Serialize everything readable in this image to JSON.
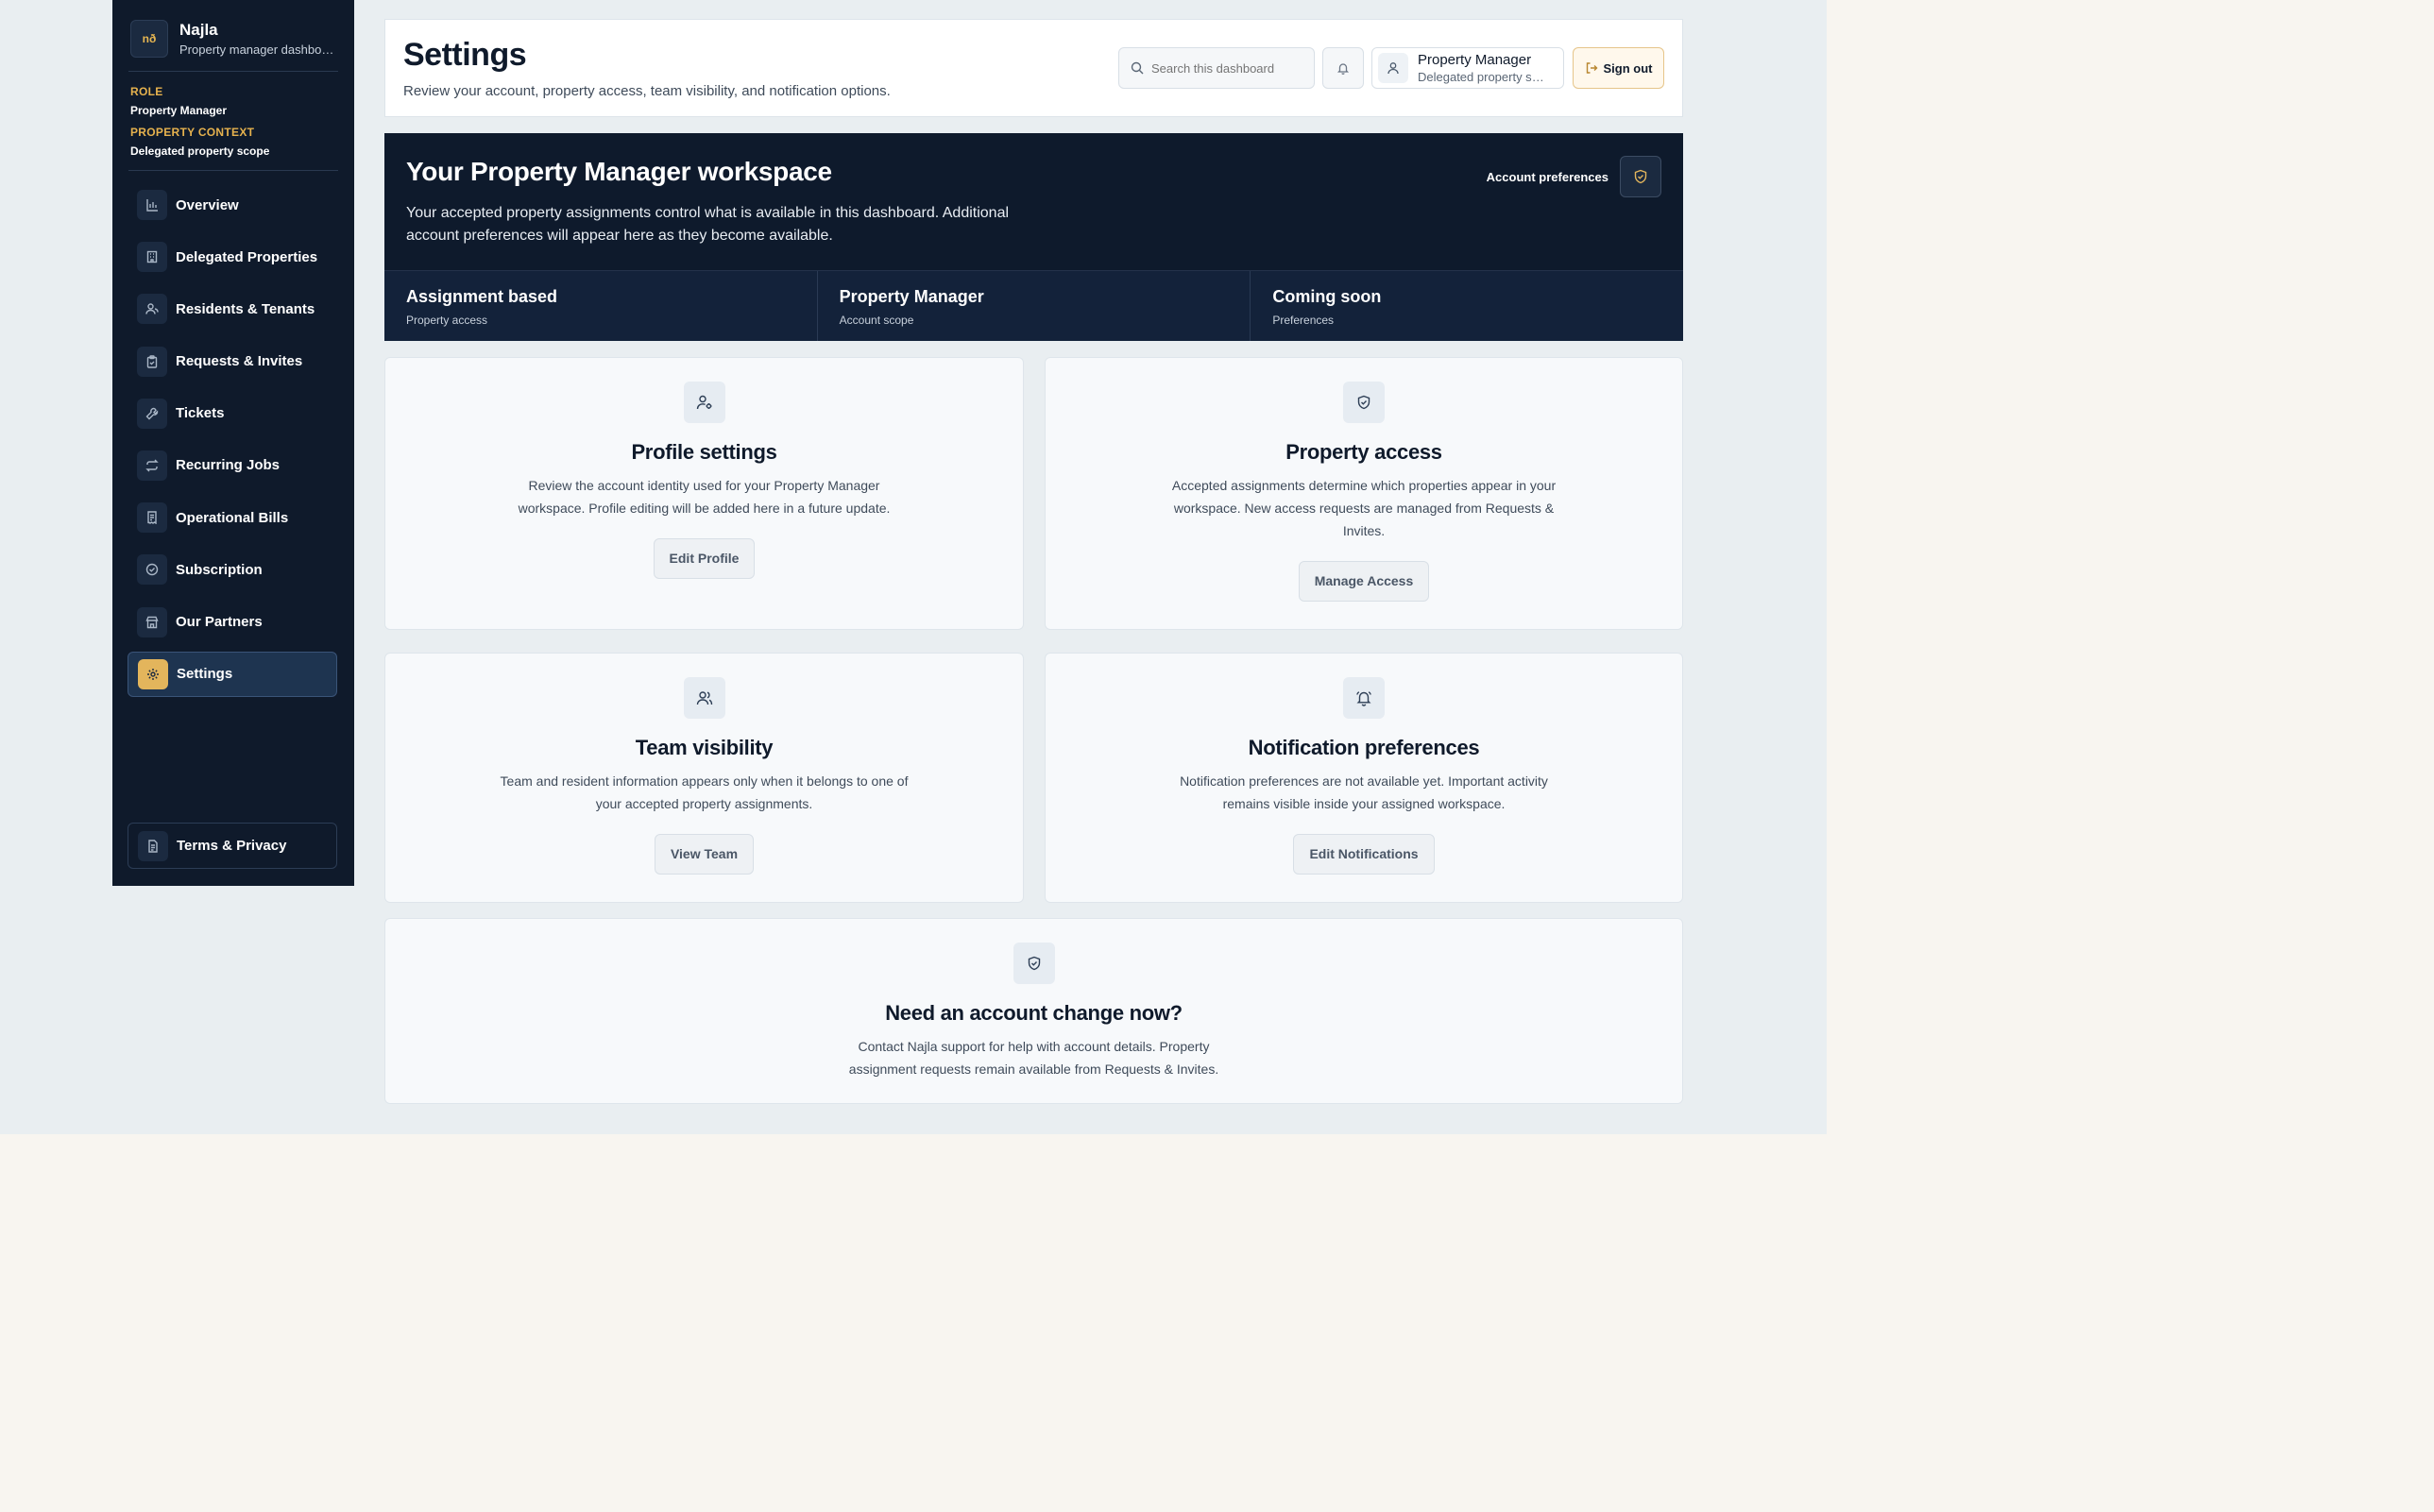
{
  "sidebar": {
    "brand": {
      "logo_text": "nð",
      "name": "Najla",
      "subtitle": "Property manager dashboard"
    },
    "role": {
      "label": "ROLE",
      "value": "Property Manager"
    },
    "context": {
      "label": "PROPERTY CONTEXT",
      "value": "Delegated property scope"
    },
    "items": [
      {
        "label": "Overview",
        "icon": "bar-chart-icon"
      },
      {
        "label": "Delegated Properties",
        "icon": "building-icon"
      },
      {
        "label": "Residents & Tenants",
        "icon": "users-icon"
      },
      {
        "label": "Requests & Invites",
        "icon": "clipboard-icon"
      },
      {
        "label": "Tickets",
        "icon": "wrench-icon"
      },
      {
        "label": "Recurring Jobs",
        "icon": "repeat-icon"
      },
      {
        "label": "Operational Bills",
        "icon": "receipt-icon"
      },
      {
        "label": "Subscription",
        "icon": "check-circle-icon"
      },
      {
        "label": "Our Partners",
        "icon": "store-icon"
      },
      {
        "label": "Settings",
        "icon": "gear-icon",
        "active": true
      }
    ],
    "footer": {
      "label": "Terms & Privacy",
      "icon": "document-icon"
    }
  },
  "header": {
    "title": "Settings",
    "subtitle": "Review your account, property access, team visibility, and notification options.",
    "search_placeholder": "Search this dashboard",
    "user": {
      "name": "Property Manager",
      "scope": "Delegated property scope"
    },
    "signout_label": "Sign out"
  },
  "hero": {
    "title": "Your Property Manager workspace",
    "description": "Your accepted property assignments control what is available in this dashboard. Additional account preferences will appear here as they become available.",
    "pref_label": "Account preferences",
    "stats": [
      {
        "title": "Assignment based",
        "sub": "Property access"
      },
      {
        "title": "Property Manager",
        "sub": "Account scope"
      },
      {
        "title": "Coming soon",
        "sub": "Preferences"
      }
    ]
  },
  "cards": {
    "profile": {
      "title": "Profile settings",
      "desc": "Review the account identity used for your Property Manager workspace. Profile editing will be added here in a future update.",
      "button": "Edit Profile"
    },
    "access": {
      "title": "Property access",
      "desc": "Accepted assignments determine which properties appear in your workspace. New access requests are managed from Requests & Invites.",
      "button": "Manage Access"
    },
    "team": {
      "title": "Team visibility",
      "desc": "Team and resident information appears only when it belongs to one of your accepted property assignments.",
      "button": "View Team"
    },
    "notifications": {
      "title": "Notification preferences",
      "desc": "Notification preferences are not available yet. Important activity remains visible inside your assigned workspace.",
      "button": "Edit Notifications"
    },
    "support": {
      "title": "Need an account change now?",
      "desc": "Contact Najla support for help with account details. Property assignment requests remain available from Requests & Invites."
    }
  },
  "colors": {
    "sidebar_bg": "#0f1a2b",
    "accent": "#e3b55c",
    "hero_bg": "#0e1a2c",
    "page_bg": "#e9eef1"
  }
}
